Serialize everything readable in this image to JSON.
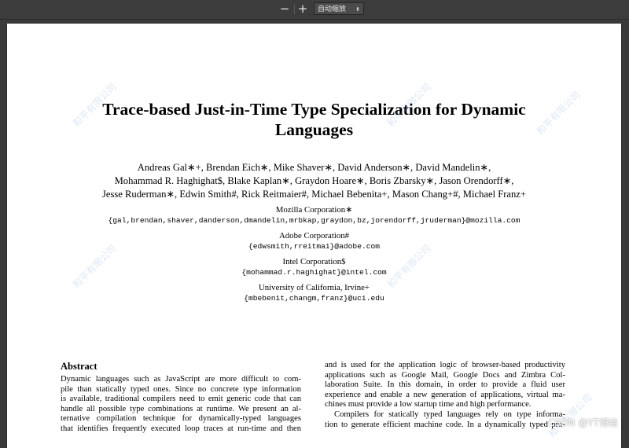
{
  "toolbar": {
    "zoom_out": "−",
    "zoom_in": "+",
    "zoom_select": "自动缩放",
    "select_arrows": "⬍"
  },
  "paper": {
    "title_line1": "Trace-based Just-in-Time Type Specialization for Dynamic",
    "title_line2": "Languages",
    "authors": [
      "Andreas Gal∗+, Brendan Eich∗, Mike Shaver∗, David Anderson∗, David Mandelin∗,",
      "Mohammad R. Haghighat$, Blake Kaplan∗, Graydon Hoare∗, Boris Zbarsky∗, Jason Orendorff∗,",
      "Jesse Ruderman∗, Edwin Smith#, Rick Reitmaier#, Michael Bebenita+, Mason Chang+#, Michael Franz+"
    ],
    "affiliations": [
      {
        "org": "Mozilla Corporation∗",
        "emails": "{gal,brendan,shaver,danderson,dmandelin,mrbkap,graydon,bz,jorendorff,jruderman}@mozilla.com"
      },
      {
        "org": "Adobe Corporation#",
        "emails": "{edwsmith,rreitmai}@adobe.com"
      },
      {
        "org": "Intel Corporation$",
        "emails": "{mohammad.r.haghighat}@intel.com"
      },
      {
        "org": "University of California, Irvine+",
        "emails": "{mbebenit,changm,franz}@uci.edu"
      }
    ],
    "abstract_heading": "Abstract",
    "left_lines": [
      "Dynamic languages such as JavaScript are more difficult to com-",
      "pile than statically typed ones. Since no concrete type information",
      "is available, traditional compilers need to emit generic code that can",
      "handle all possible type combinations at runtime. We present an al-",
      "ternative compilation technique for dynamically-typed languages",
      "that identifies frequently executed loop traces at run-time and then"
    ],
    "right_lines": [
      "and is used for the application logic of browser-based productivity",
      "applications such as Google Mail, Google Docs and Zimbra Col-",
      "laboration Suite. In this domain, in order to provide a fluid user",
      "experience and enable a new generation of applications, virtual ma-",
      "chines must provide a low startup time and high performance.",
      "Compilers for statically typed languages rely on type informa-",
      "tion to generate efficient machine code. In a dynamically typed pro-"
    ]
  },
  "watermarks": {
    "diagonal": "和平有限公司",
    "corner": "CSDN @YT博绘"
  }
}
